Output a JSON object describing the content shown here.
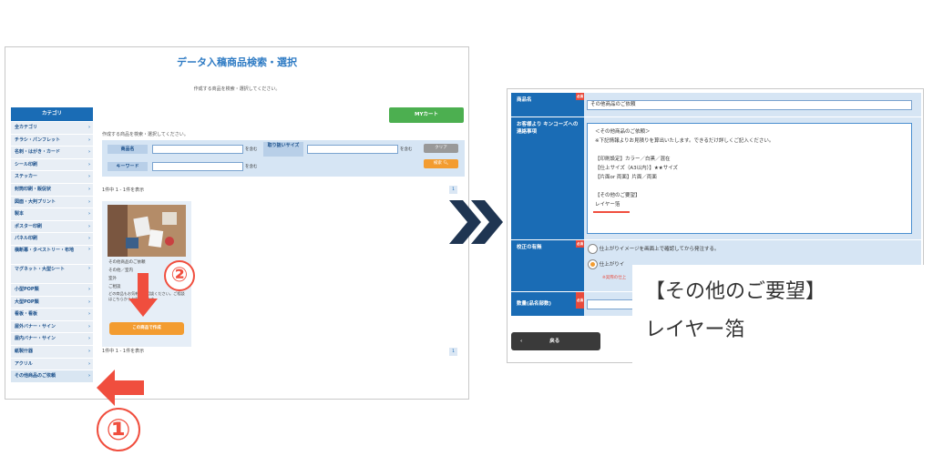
{
  "left_panel": {
    "title": "データ入稿商品検索・選択",
    "subtitle": "作成する商品を検索・選択してください。",
    "category_header": "カテゴリ",
    "categories": [
      "全カテゴリ",
      "チラシ・パンフレット",
      "名刺・はがき・カード",
      "シール印刷",
      "ステッカー",
      "封筒印刷・販促状",
      "図面・大判プリント",
      "製本",
      "ポスター印刷",
      "パネル印刷",
      "横断幕・タペストリー・布地",
      "マグネット・大型シート",
      "小型POP類",
      "大型POP類",
      "看板・看板",
      "屋外バナー・サイン",
      "屋内バナー・サイン",
      "紙製什器",
      "アクリル",
      "その他商品のご依頼"
    ],
    "mycart_label": "MYカート",
    "search_description": "作成する商品を検索・選択してください。",
    "search": {
      "product_name_label": "商品名",
      "size_label": "取り扱いサイズ",
      "keyword_label": "キーワード",
      "contains": "を含む",
      "clear_label": "クリア",
      "search_label": "検索"
    },
    "result_count": "1件中 1 - 1件を表示",
    "page_number": "1",
    "card": {
      "name": "その他商品のご依頼",
      "category": "その他／室内",
      "line3": "室外",
      "line4": "ご相談",
      "desc": "どの商品もお気軽にご相談ください。ご相談はこちらからお願いします",
      "create_button": "この商品で作成"
    },
    "annotation_1": "①",
    "annotation_2": "②"
  },
  "right_panel": {
    "product_label": "商品名",
    "required": "必須",
    "product_value": "その他商品のご依頼",
    "notes_label": "お客様より キンコーズへの 連絡事項",
    "notes_lines": [
      "＜その他商品のご依頼＞",
      "※下記情報よりお見積りを算出いたします。できるだけ詳しくご記入ください。",
      "",
      "【印刷設定】カラー／白黒／混在",
      "【仕上サイズ（A3以内）】★★サイズ",
      "【片面or 両面】片面／両面",
      "",
      "【その他のご要望】",
      "レイヤー箔"
    ],
    "proof_label": "校正の有無",
    "proof_option_1": "仕上がりイメージを画面上で確認してから発注する。",
    "proof_option_2": "仕上がりイ",
    "proof_note": "※実際の仕上",
    "quantity_label": "数量(品名部数)",
    "back_label": "戻る",
    "zoom_line1": "【その他のご要望】",
    "zoom_line2": "レイヤー箔"
  },
  "colors": {
    "accent": "#1a6cb5",
    "orange": "#f39c30",
    "green": "#4caf50",
    "annotation": "#f04e3e",
    "navy_arrow": "#1f3552"
  }
}
